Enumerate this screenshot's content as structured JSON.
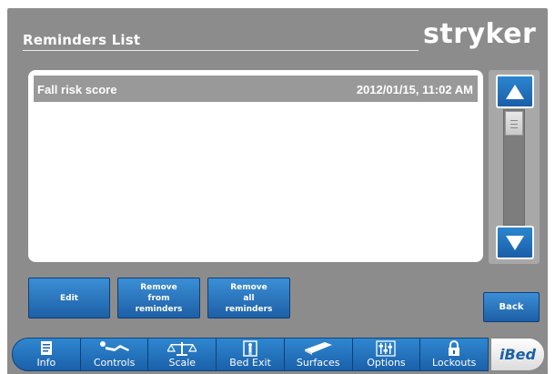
{
  "header": {
    "title": "Reminders List",
    "logo": "stryker"
  },
  "reminders": [
    {
      "name": "Fall risk score",
      "datetime": "2012/01/15, 11:02 AM"
    }
  ],
  "scrollbar": {
    "up_icon": "up-arrow-icon",
    "down_icon": "down-arrow-icon",
    "thumb_icon": "grip-icon"
  },
  "actions": {
    "edit": "Edit",
    "remove_from": "Remove\nfrom\nreminders",
    "remove_all": "Remove\nall\nreminders",
    "back": "Back"
  },
  "tabs": [
    {
      "label": "Info",
      "icon": "document-icon"
    },
    {
      "label": "Controls",
      "icon": "patient-bed-icon"
    },
    {
      "label": "Scale",
      "icon": "scale-icon"
    },
    {
      "label": "Bed Exit",
      "icon": "bed-exit-icon"
    },
    {
      "label": "Surfaces",
      "icon": "mattress-icon"
    },
    {
      "label": "Options",
      "icon": "sliders-icon"
    },
    {
      "label": "Lockouts",
      "icon": "lock-icon"
    }
  ],
  "brand_tab": {
    "label": "iBed"
  },
  "colors": {
    "accent_blue": "#1d6fbf",
    "panel_gray": "#8c8c8c",
    "selected_row": "#999999"
  }
}
